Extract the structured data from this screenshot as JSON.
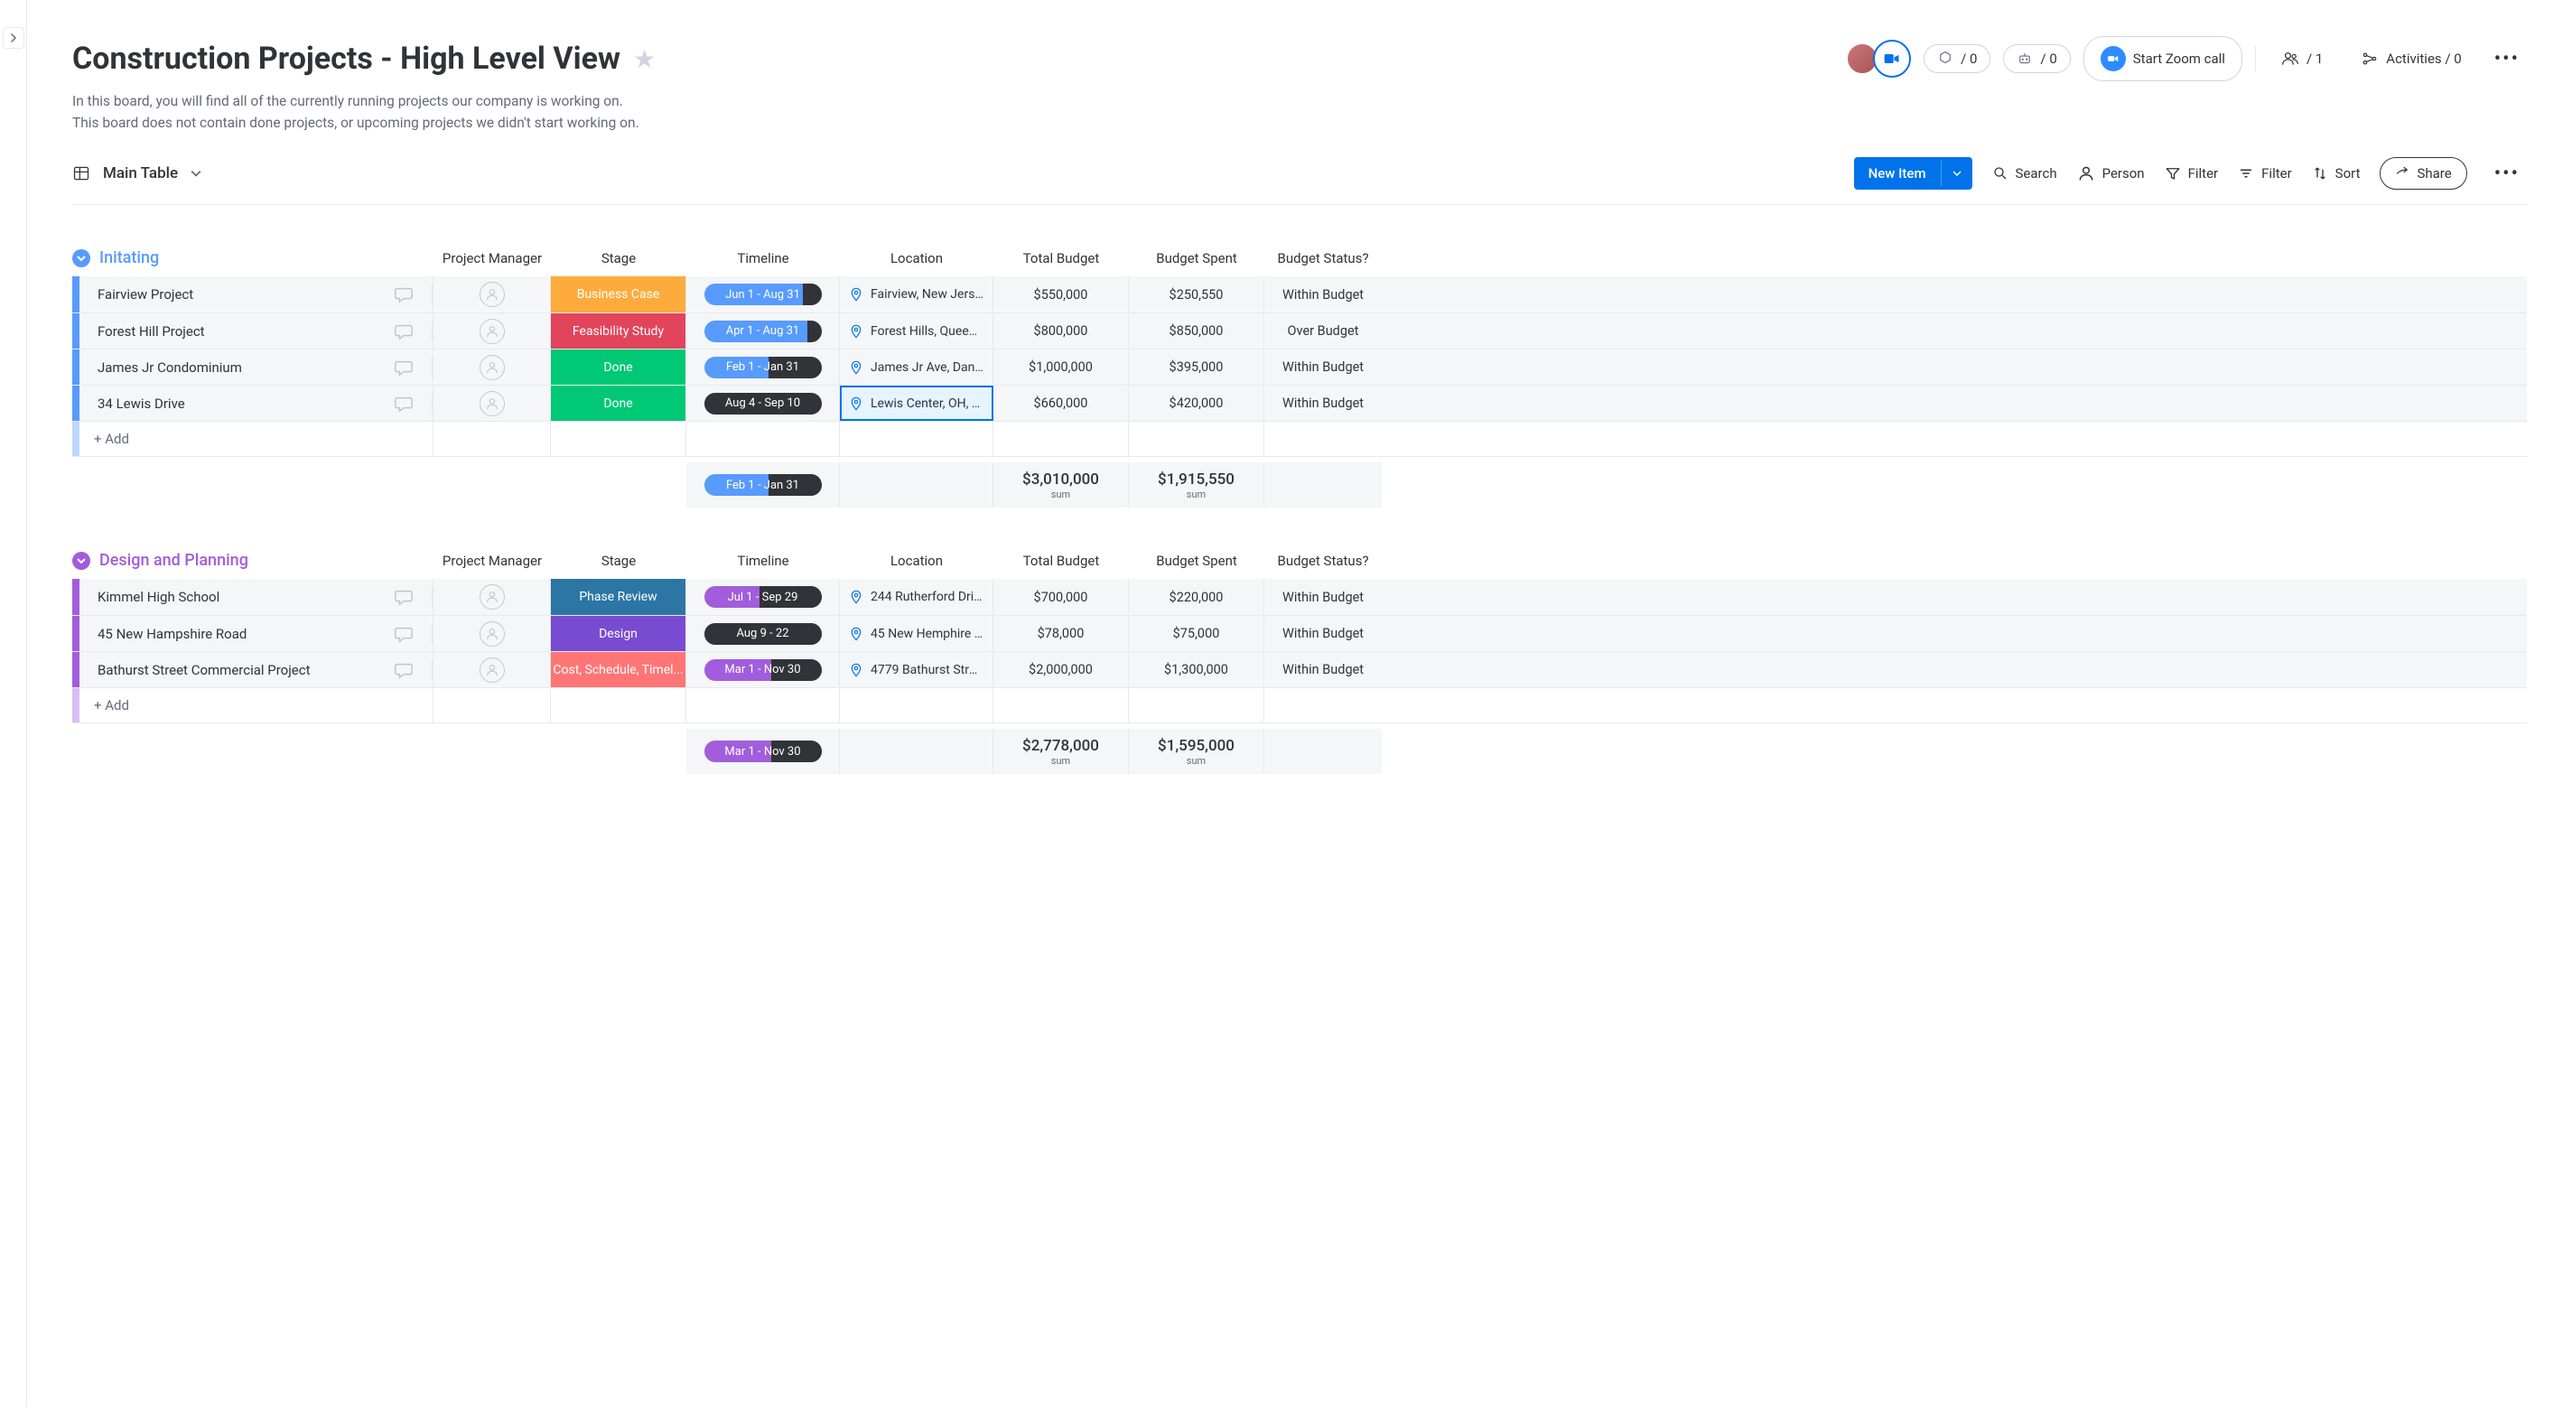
{
  "header": {
    "title": "Construction Projects - High Level View",
    "desc_line1": "In this board, you will find all of the currently running projects our company is working on.",
    "desc_line2": "This board does not contain done projects, or upcoming projects we didn't start working on.",
    "integrations_count": "/ 0",
    "automations_count": "/ 0",
    "zoom_label": "Start Zoom call",
    "people_count": "/ 1",
    "activities_label": "Activities / 0"
  },
  "view": {
    "name": "Main Table",
    "new_item": "New Item",
    "search": "Search",
    "person": "Person",
    "filter1": "Filter",
    "filter2": "Filter",
    "sort": "Sort",
    "share": "Share"
  },
  "columns": {
    "pm": "Project Manager",
    "stage": "Stage",
    "timeline": "Timeline",
    "location": "Location",
    "budget": "Total Budget",
    "spent": "Budget Spent",
    "status": "Budget Status?"
  },
  "add_label": "+ Add",
  "sum_label": "sum",
  "groups": [
    {
      "id": "initiating",
      "title": "Initating",
      "color": "#579bfc",
      "rows": [
        {
          "name": "Fairview Project",
          "stage": "Business Case",
          "stage_color": "#fdab3d",
          "tl": "Jun 1 - Aug 31",
          "tl_dark": 16,
          "location": "Fairview, New Jerse...",
          "budget": "$550,000",
          "spent": "$250,550",
          "status": "Within Budget",
          "selected": false
        },
        {
          "name": "Forest Hill Project",
          "stage": "Feasibility Study",
          "stage_color": "#e2445c",
          "tl": "Apr 1 - Aug 31",
          "tl_dark": 12,
          "location": "Forest Hills, Queens,...",
          "budget": "$800,000",
          "spent": "$850,000",
          "status": "Over Budget",
          "selected": false
        },
        {
          "name": "James Jr Condominium",
          "stage": "Done",
          "stage_color": "#00c875",
          "tl": "Feb 1 - Jan 31",
          "tl_dark": 45,
          "location": "James Jr Ave, Danie...",
          "budget": "$1,000,000",
          "spent": "$395,000",
          "status": "Within Budget",
          "selected": false
        },
        {
          "name": "34 Lewis Drive",
          "stage": "Done",
          "stage_color": "#00c875",
          "tl": "Aug 4 - Sep 10",
          "tl_dark": 100,
          "location": "Lewis Center, OH, U...",
          "budget": "$660,000",
          "spent": "$420,000",
          "status": "Within Budget",
          "selected": true
        }
      ],
      "summary": {
        "tl": "Feb 1 - Jan 31",
        "tl_dark": 45,
        "budget": "$3,010,000",
        "spent": "$1,915,550"
      }
    },
    {
      "id": "design",
      "title": "Design and Planning",
      "color": "#a25ddc",
      "rows": [
        {
          "name": "Kimmel High School",
          "stage": "Phase Review",
          "stage_color": "#2b76a5",
          "tl": "Jul 1 - Sep 29",
          "tl_dark": 53,
          "location": "244 Rutherford Drive...",
          "budget": "$700,000",
          "spent": "$220,000",
          "status": "Within Budget",
          "selected": false
        },
        {
          "name": "45 New Hampshire Road",
          "stage": "Design",
          "stage_color": "#784bd1",
          "tl": "Aug 9 - 22",
          "tl_dark": 100,
          "location": "45 New Hemphire R...",
          "budget": "$78,000",
          "spent": "$75,000",
          "status": "Within Budget",
          "selected": false
        },
        {
          "name": "Bathurst Street Commercial Project",
          "stage": "Cost, Schedule, Timel...",
          "stage_color": "#ff7575",
          "tl": "Mar 1 - Nov 30",
          "tl_dark": 43,
          "location": "4779 Bathurst Street...",
          "budget": "$2,000,000",
          "spent": "$1,300,000",
          "status": "Within Budget",
          "selected": false
        }
      ],
      "summary": {
        "tl": "Mar 1 - Nov 30",
        "tl_dark": 43,
        "budget": "$2,778,000",
        "spent": "$1,595,000"
      }
    }
  ]
}
